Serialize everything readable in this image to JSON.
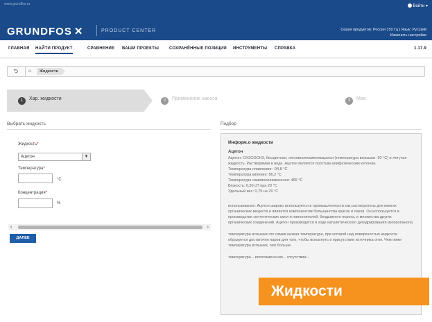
{
  "header": {
    "url": "www.grundfos.ru",
    "login": "Войти",
    "brand": "GRUNDFOS",
    "brand_mark": "✕",
    "product_center": "PRODUCT CENTER",
    "catalog_line": "Серия продуктов: Россия | 50 Гц | Язык: Русский",
    "settings_link": "Изменить настройки"
  },
  "nav": {
    "items": [
      "ГЛАВНАЯ",
      "НАЙТИ ПРОДУКТ",
      "СРАВНЕНИЕ",
      "ВАШИ ПРОЕКТЫ",
      "СОХРАНЁННЫЕ ПОЗИЦИИ",
      "ИНСТРУМЕНТЫ",
      "СПРАВКА"
    ],
    "version": "1.17.9"
  },
  "breadcrumb": {
    "current": "Жидкости"
  },
  "steps": [
    {
      "num": "1",
      "label": "Хар. жидкости",
      "state": "active"
    },
    {
      "num": "2",
      "label": "Применение насоса",
      "state": "inactive"
    },
    {
      "num": "3",
      "label": "Мое",
      "state": "inactive"
    }
  ],
  "left": {
    "heading": "Выбрать жидкость",
    "fluid_label": "Жидкость",
    "fluid_value": "Ацетон",
    "temp_label": "Температура",
    "temp_unit": "°C",
    "conc_label": "Концентрация",
    "conc_unit": "%",
    "required_mark": "*",
    "next_button": "ДАЛЕЕ"
  },
  "right": {
    "heading": "Подбор",
    "info_title": "Информ.о жидкости",
    "fluid_name": "Ацетон",
    "description": "Ацетон: CH3COCH3, бесцветная, легковоспламеняющаяся (температура вспышки -20 °C) и летучая жидкость. Растворимая в воде. Ацетон является простым алифатическим кетоном.",
    "melt": "Температура плавления: -94,8 °C",
    "boil": "Температура кипения: 56,2 °C",
    "ignite": "Температура самовоспламенения: 465 °C",
    "viscosity": "Вязкость: 0,30 сП при 20 °C",
    "density": "Удельный вес: 0,79 на 20 °C",
    "usage": "использование: Ацетон широко используется в промышленности как растворитель для многих органических веществ и является компонентом большинства красок и лаков. Он используется в производстве синтетических смол в наполнителей, бездымного пороха, в множества других органических соединений. Ацетон производится в ходе каталитического дегидрирования изопропанола.",
    "flash": "температура вспышки это самая низкая температура, при которой над поверхностью жидкости образуется достаточно паров для того, чтобы вспыхнуть в присутствии источника огня. Чем ниже температура вспышки, тем больше",
    "extra": "температура... воспламенения... отсутствии..."
  },
  "banner": "Жидкости"
}
